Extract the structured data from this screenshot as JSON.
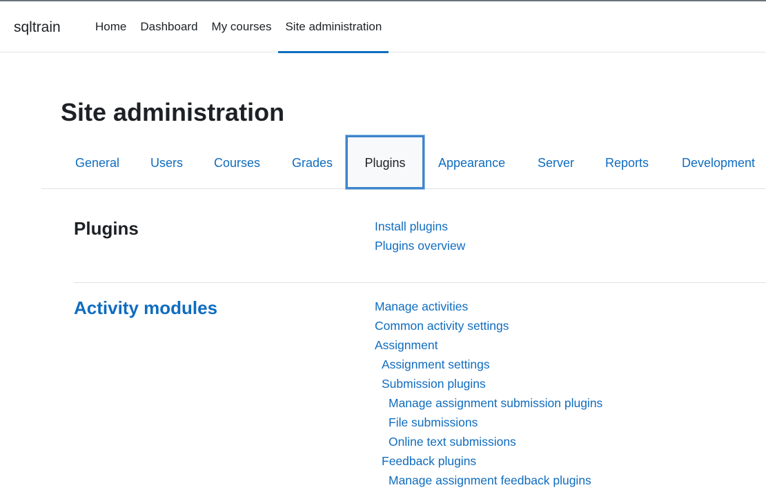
{
  "header": {
    "brand": "sqltrain",
    "nav": [
      {
        "label": "Home"
      },
      {
        "label": "Dashboard"
      },
      {
        "label": "My courses"
      },
      {
        "label": "Site administration"
      }
    ]
  },
  "page": {
    "title": "Site administration"
  },
  "tabs": [
    {
      "label": "General"
    },
    {
      "label": "Users"
    },
    {
      "label": "Courses"
    },
    {
      "label": "Grades"
    },
    {
      "label": "Plugins"
    },
    {
      "label": "Appearance"
    },
    {
      "label": "Server"
    },
    {
      "label": "Reports"
    },
    {
      "label": "Development"
    }
  ],
  "plugins_section": {
    "heading": "Plugins",
    "links": [
      {
        "label": "Install plugins"
      },
      {
        "label": "Plugins overview"
      }
    ]
  },
  "activity_section": {
    "heading": "Activity modules",
    "links": [
      {
        "label": "Manage activities"
      },
      {
        "label": "Common activity settings"
      },
      {
        "label": "Assignment"
      },
      {
        "label": "Assignment settings"
      },
      {
        "label": "Submission plugins"
      },
      {
        "label": "Manage assignment submission plugins"
      },
      {
        "label": "File submissions"
      },
      {
        "label": "Online text submissions"
      },
      {
        "label": "Feedback plugins"
      },
      {
        "label": "Manage assignment feedback plugins"
      }
    ]
  }
}
